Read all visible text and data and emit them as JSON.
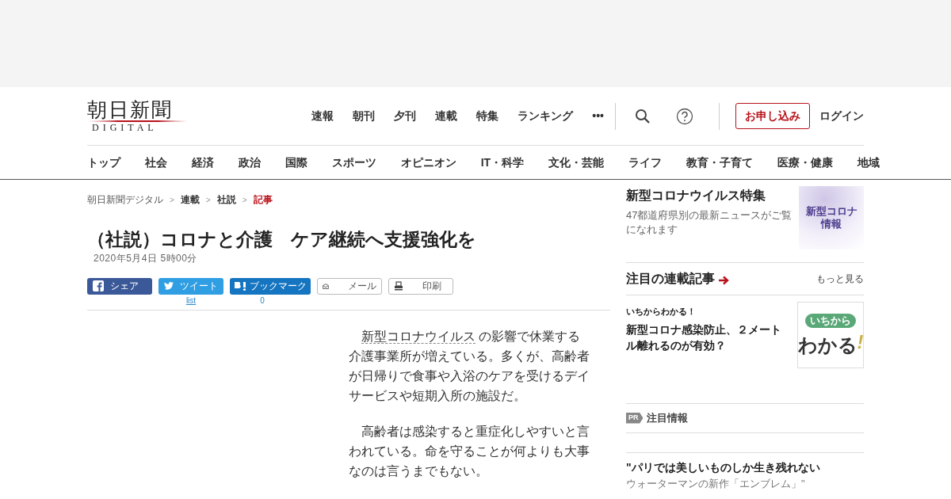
{
  "logo": {
    "title": "朝日新聞",
    "subtitle": "DIGITAL"
  },
  "top_nav": [
    "速報",
    "朝刊",
    "夕刊",
    "連載",
    "特集",
    "ランキング",
    "•••"
  ],
  "header_buttons": [
    {
      "kind": "outline",
      "label": "お申し込み"
    },
    {
      "kind": "plain",
      "label": "ログイン"
    }
  ],
  "category_nav": [
    "トップ",
    "社会",
    "経済",
    "政治",
    "国際",
    "スポーツ",
    "オピニオン",
    "IT・科学",
    "文化・芸能",
    "ライフ",
    "教育・子育て",
    "医療・健康",
    "地域"
  ],
  "breadcrumb": [
    {
      "label": "朝日新聞デジタル",
      "current": false
    },
    {
      "label": "連載",
      "current": false
    },
    {
      "label": "社説",
      "current": false
    },
    {
      "label": "記事",
      "current": true
    }
  ],
  "breadcrumb_separator": ">",
  "article": {
    "title": "（社説）コロナと介護　ケア継続へ支援強化を",
    "date": "2020年5月4日 5時00分",
    "share_buttons": [
      {
        "kind": "facebook",
        "label": "シェア"
      },
      {
        "kind": "twitter",
        "label": "ツイート",
        "count": "list"
      },
      {
        "kind": "hatena",
        "label": "ブックマーク",
        "count": "0"
      },
      {
        "kind": "mail",
        "label": "メール"
      },
      {
        "kind": "print",
        "label": "印刷"
      }
    ],
    "paragraphs": [
      {
        "link": "新型コロナウイルス",
        "text": " の影響で休業する介護事業所が増えている。多くが、高齢者が日帰りで食事や入浴のケアを受けるデイサービスや短期入所の施設だ。"
      },
      {
        "text": "高齢者は感染すると重症化しやすいと言われている。命を守ることが何よりも大事なのは言うまでもない。"
      }
    ]
  },
  "sidebar": {
    "feature": {
      "title": "新型コロナウイルス特集",
      "description": "47都道府県別の最新ニュースがご覧になれます",
      "banner": "新型コロナ情報"
    },
    "series": {
      "heading": "注目の連載記事",
      "more": "もっと見る",
      "items": [
        {
          "kicker": "いちからわかる！",
          "title": "新型コロナ感染防止、２メートル離れるのが有効？",
          "logo_top": "いちから",
          "logo_bottom": "わかる",
          "logo_mark": "!"
        }
      ]
    },
    "pr": {
      "badge": "PR",
      "heading": "注目情報",
      "items": [
        {
          "title": "\"パリでは美しいものしか生き残れない",
          "subtitle": "ウォーターマンの新作「エンブレム」\""
        }
      ]
    }
  }
}
